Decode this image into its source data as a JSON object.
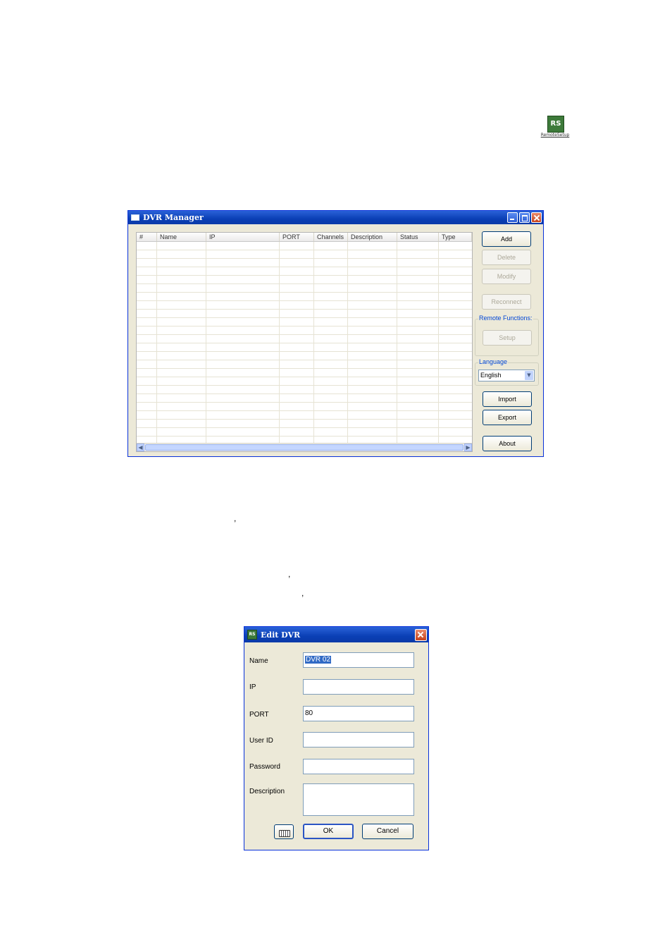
{
  "desktop_icon": {
    "glyph": "RS",
    "caption": "RemoteSetup"
  },
  "dvr_manager": {
    "title": "DVR Manager",
    "columns": [
      "#",
      "Name",
      "IP",
      "PORT",
      "Channels",
      "Description",
      "Status",
      "Type"
    ],
    "rows": [],
    "buttons": {
      "add": "Add",
      "delete": "Delete",
      "modify": "Modify",
      "reconnect": "Reconnect",
      "setup": "Setup",
      "import": "Import",
      "export": "Export",
      "about": "About"
    },
    "remote_functions_label": "Remote Functions:",
    "language_label": "Language",
    "language_value": "English"
  },
  "edit_dvr": {
    "title": "Edit DVR",
    "icon": "RS",
    "labels": {
      "name": "Name",
      "ip": "IP",
      "port": "PORT",
      "user_id": "User ID",
      "password": "Password",
      "description": "Description"
    },
    "values": {
      "name": "DVR 02",
      "ip": "",
      "port": "80",
      "user_id": "",
      "password": "",
      "description": ""
    },
    "ok": "OK",
    "cancel": "Cancel"
  },
  "stray_marks": [
    ",",
    ",",
    ","
  ]
}
